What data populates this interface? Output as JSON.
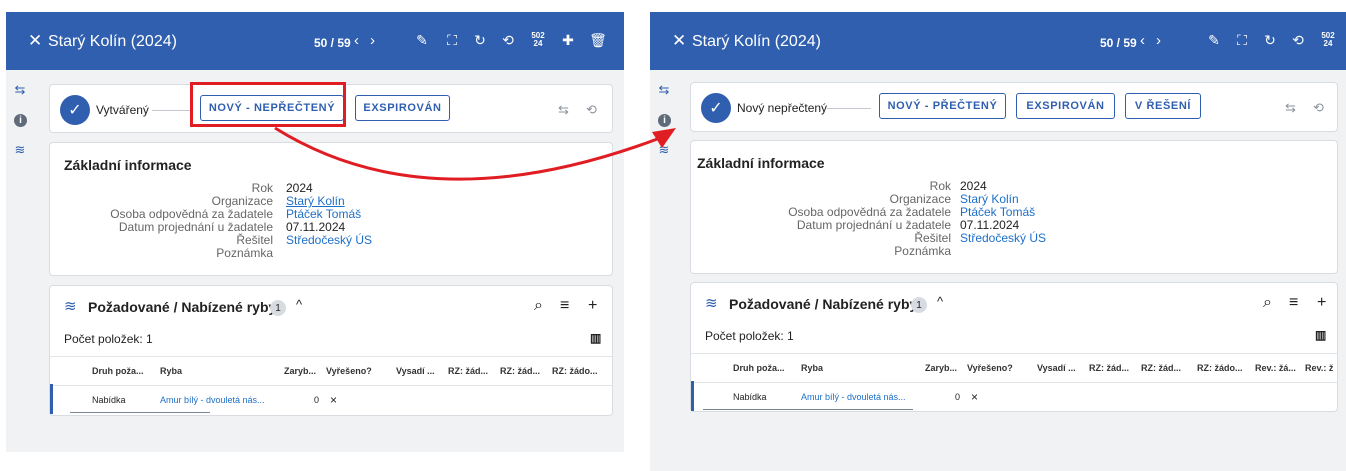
{
  "header": {
    "title": "Starý Kolín (2024)",
    "pager": "50 / 59",
    "prev": "‹",
    "next": "›",
    "close_icon": "close-icon",
    "year_icon_text": "502\n24"
  },
  "status_left": {
    "current": "Vytvářený",
    "buttons": [
      "NOVÝ - NEPŘEČTENÝ",
      "EXSPIROVÁN"
    ]
  },
  "status_right": {
    "current": "Nový nepřečtený",
    "buttons": [
      "NOVÝ - PŘEČTENÝ",
      "EXSPIROVÁN",
      "V ŘEŠENÍ"
    ]
  },
  "basic": {
    "title": "Základní informace",
    "labels": [
      "Rok",
      "Organizace",
      "Osoba odpovědná za žadatele",
      "Datum projednání u žadatele",
      "Řešitel",
      "Poznámka"
    ],
    "values": [
      "2024",
      "Starý Kolín",
      "Ptáček Tomáš",
      "07.11.2024",
      "Středočeský ÚS",
      ""
    ]
  },
  "fish": {
    "title": "Požadované / Nabízené ryby",
    "badge": "1",
    "count_label": "Počet položek: 1",
    "columns_left": [
      "Druh poža...",
      "Ryba",
      "Zaryb...",
      "Vyřešeno?",
      "Vysadí ...",
      "RZ: žád...",
      "RZ: žád...",
      "RZ: žádo..."
    ],
    "columns_right": [
      "Druh poža...",
      "Ryba",
      "Zaryb...",
      "Vyřešeno?",
      "Vysadí ...",
      "RZ: žád...",
      "RZ: žád...",
      "RZ: žádo...",
      "Rev.: žá...",
      "Rev.: ž"
    ],
    "row": {
      "druh": "Nabídka",
      "ryba": "Amur bílý - dvouletá nás...",
      "zaryb": "0",
      "vyreseno": "×"
    }
  },
  "colors": {
    "header": "#2f5fae",
    "highlight": "#e11d24",
    "link": "#1e6fc7"
  }
}
